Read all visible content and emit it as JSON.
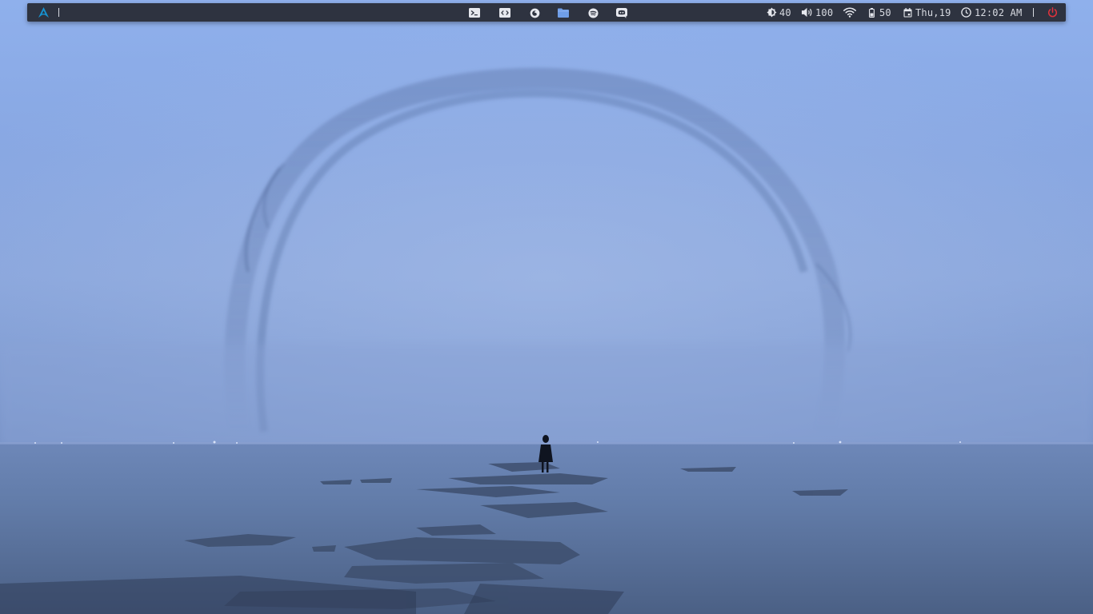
{
  "topbar": {
    "launcher": {
      "icon": "arch-linux-logo-icon"
    },
    "taskbar": [
      {
        "name": "terminal",
        "icon": "terminal-icon"
      },
      {
        "name": "code-editor",
        "icon": "code-icon"
      },
      {
        "name": "firefox",
        "icon": "firefox-icon"
      },
      {
        "name": "files",
        "icon": "folder-icon"
      },
      {
        "name": "spotify",
        "icon": "spotify-icon"
      },
      {
        "name": "discord",
        "icon": "discord-icon"
      }
    ],
    "status": {
      "brightness": "40",
      "volume": "100",
      "wifi_icon": "wifi-icon",
      "battery": "50",
      "date": "Thu,19",
      "time": "12:02 AM",
      "power_icon": "power-icon"
    },
    "colors": {
      "bar_bg": "#2e3340",
      "text": "#d8dbe2",
      "accent_blue": "#1793d1",
      "folder_blue": "#6f9ee8",
      "power_red": "#e0323c"
    }
  }
}
